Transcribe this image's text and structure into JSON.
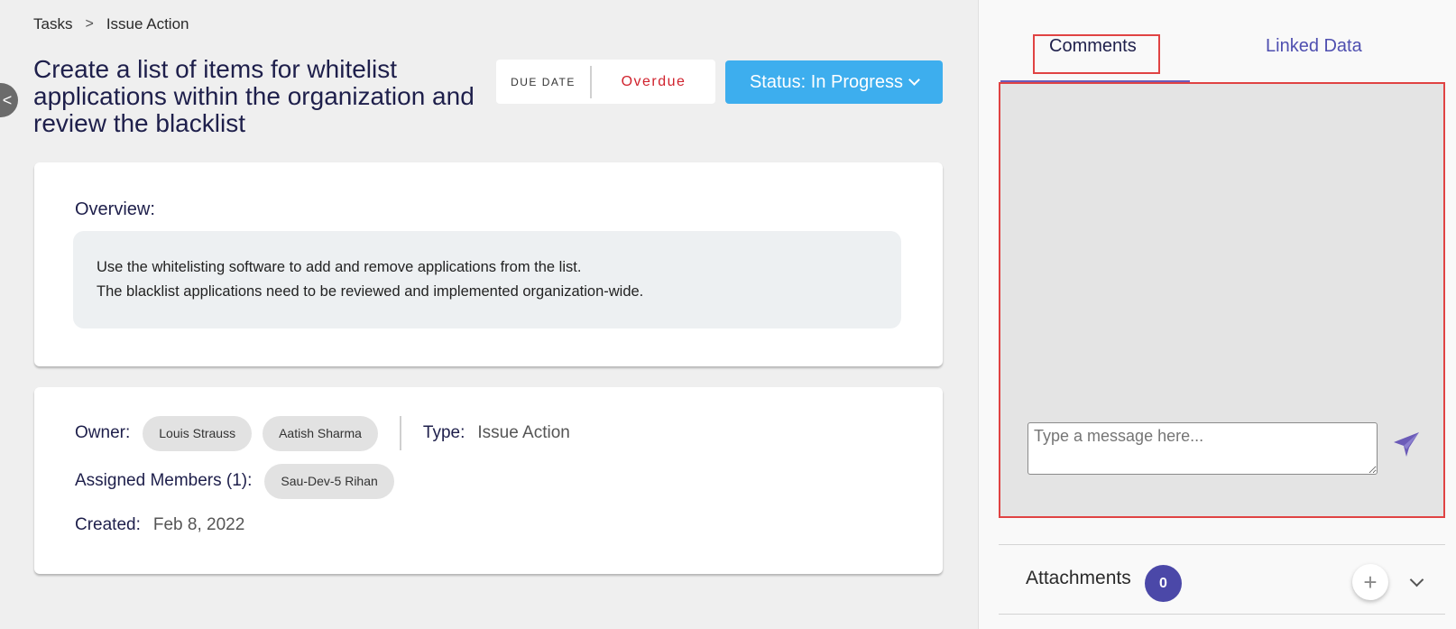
{
  "breadcrumb": {
    "root": "Tasks",
    "separator": ">",
    "current": "Issue Action"
  },
  "collapse": {
    "icon": "chevron-left-icon",
    "glyph": "<"
  },
  "task": {
    "title": "Create a list of items for whitelist applications within the organization and review the blacklist",
    "due_label": "DUE DATE",
    "due_value": "Overdue",
    "status_label": "Status: In Progress"
  },
  "overview": {
    "label": "Overview:",
    "lines": [
      "Use the whitelisting software to add and remove applications from the list.",
      "The blacklist applications need to be reviewed and implemented organization-wide."
    ]
  },
  "details": {
    "owner_label": "Owner:",
    "owners": [
      "Louis Strauss",
      "Aatish Sharma"
    ],
    "type_label": "Type:",
    "type_value": "Issue Action",
    "assigned_label": "Assigned Members (1):",
    "assigned": [
      "Sau-Dev-5 Rihan"
    ],
    "created_label": "Created:",
    "created_value": "Feb 8, 2022"
  },
  "side": {
    "tabs": [
      "Comments",
      "Linked Data"
    ],
    "active_tab": "Comments",
    "message_placeholder": "Type a message here...",
    "send_icon": "send-icon",
    "attachments_label": "Attachments",
    "attachments_count": "0",
    "add_glyph": "+"
  },
  "colors": {
    "accent": "#3daeee",
    "title": "#1e1f4b",
    "overdue": "#d0222d",
    "badge": "#4b48a8",
    "highlight": "#e04343"
  }
}
